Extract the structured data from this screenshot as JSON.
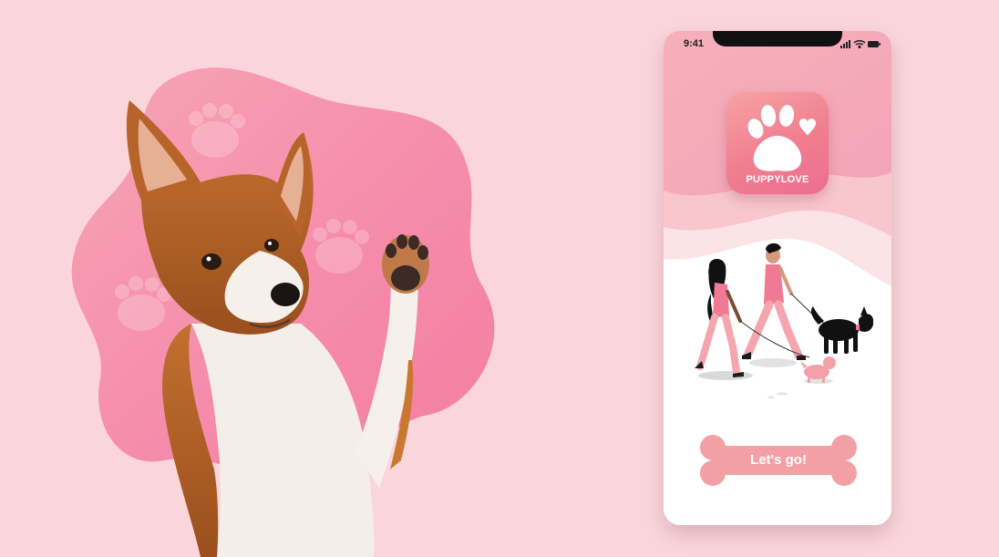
{
  "status_bar": {
    "time": "9:41"
  },
  "app": {
    "name": "PUPPYLOVE",
    "cta_label": "Let's go!"
  },
  "icons": {
    "logo": "paw-heart-icon",
    "signal": "signal-icon",
    "wifi": "wifi-icon",
    "battery": "battery-icon"
  },
  "colors": {
    "background": "#fad6dc",
    "accent": "#f07e8e",
    "blob": "#f58aa6",
    "button": "#f3a0a4"
  }
}
